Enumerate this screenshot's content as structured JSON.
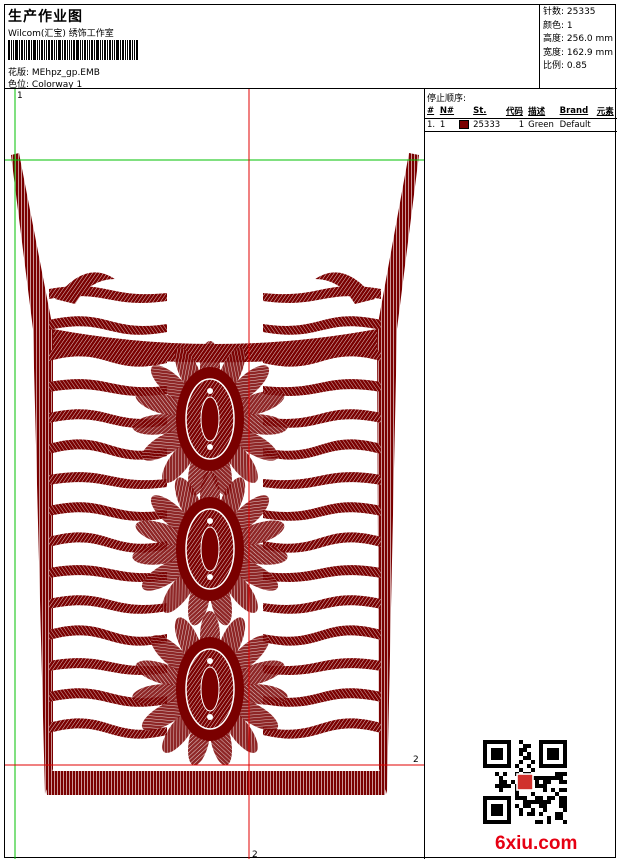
{
  "header": {
    "title": "生产作业图",
    "company": "Wilcom(汇宝) 绣饰工作室",
    "design_label": "花版:",
    "design_value": "MEhpz_gp.EMB",
    "colorway_label": "色位:",
    "colorway_value": "Colorway 1"
  },
  "stats": {
    "stitches": "针数: 25335",
    "colors": "颜色: 1",
    "height": "高度: 256.0 mm",
    "width": "宽度: 162.9 mm",
    "scale": "比例: 0.85"
  },
  "sequence": {
    "title": "停止顺序:",
    "columns": [
      "#",
      "N#",
      "St.",
      "代码",
      "描述",
      "Brand",
      "元素"
    ],
    "rows": [
      {
        "num": "1.",
        "n": "1",
        "swatch_color": "#7a0000",
        "stitches": "25333",
        "code": "1",
        "desc": "Green",
        "brand": "Default",
        "element": ""
      }
    ]
  },
  "guides": {
    "top_left": "1",
    "right": "2",
    "bottom": "2"
  },
  "colors": {
    "thread": "#7a0000",
    "guide_red": "#e00000",
    "guide_green": "#00c000"
  },
  "watermark": {
    "text": "6xiu.com"
  }
}
